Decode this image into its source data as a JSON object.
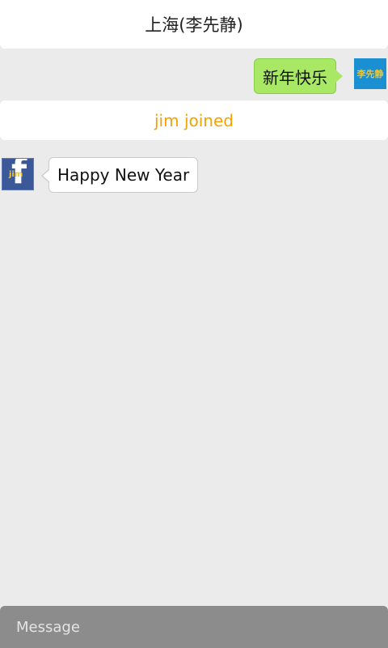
{
  "header": {
    "title": "上海(李先静)"
  },
  "messages": [
    {
      "direction": "outgoing",
      "text": "新年快乐",
      "avatar_label": "李先静",
      "bubble_color": "#a8e865"
    },
    {
      "direction": "system",
      "text": "jim joined",
      "text_color": "#f5a100"
    },
    {
      "direction": "incoming",
      "text": "Happy New Year",
      "avatar_label": "jim",
      "avatar_icon": "facebook-icon",
      "bubble_color": "#ffffff"
    }
  ],
  "composer": {
    "placeholder": "Message",
    "value": ""
  }
}
